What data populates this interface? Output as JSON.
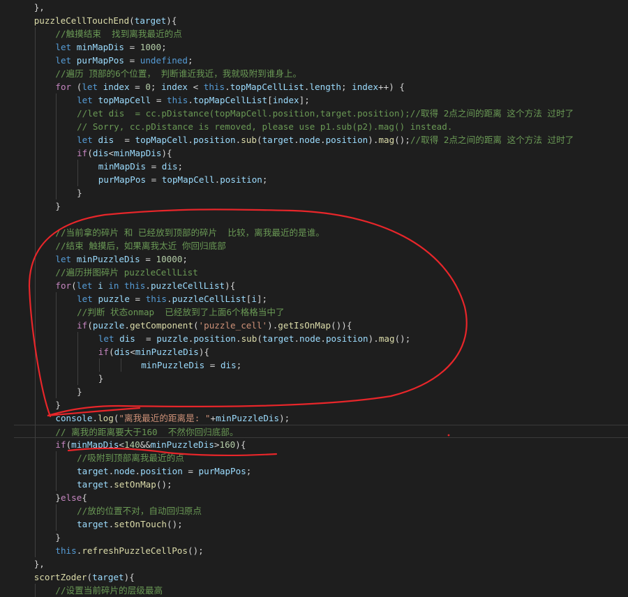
{
  "editor": {
    "lines": [
      {
        "indent": 1,
        "tokens": [
          [
            "},",
            "p"
          ]
        ]
      },
      {
        "indent": 1,
        "tokens": [
          [
            "puzzleCellTouchEnd",
            "f"
          ],
          [
            "(",
            "p"
          ],
          [
            "target",
            "v"
          ],
          [
            "){",
            "p"
          ]
        ]
      },
      {
        "indent": 2,
        "tokens": [
          [
            "//触摸结束  找到离我最近的点",
            "c"
          ]
        ]
      },
      {
        "indent": 2,
        "tokens": [
          [
            "let ",
            "k"
          ],
          [
            "minMapDis",
            "v"
          ],
          [
            " = ",
            "p"
          ],
          [
            "1000",
            "n"
          ],
          [
            ";",
            "p"
          ]
        ]
      },
      {
        "indent": 2,
        "tokens": [
          [
            "let ",
            "k"
          ],
          [
            "purMapPos",
            "v"
          ],
          [
            " = ",
            "p"
          ],
          [
            "undefined",
            "k"
          ],
          [
            ";",
            "p"
          ]
        ]
      },
      {
        "indent": 2,
        "tokens": [
          [
            "//遍历 顶部的6个位置， 判断谁近我近，我就吸附到谁身上。",
            "c"
          ]
        ]
      },
      {
        "indent": 2,
        "tokens": [
          [
            "for",
            "x"
          ],
          [
            " (",
            "p"
          ],
          [
            "let ",
            "k"
          ],
          [
            "index",
            "v"
          ],
          [
            " = ",
            "p"
          ],
          [
            "0",
            "n"
          ],
          [
            "; ",
            "p"
          ],
          [
            "index",
            "v"
          ],
          [
            " < ",
            "p"
          ],
          [
            "this",
            "k"
          ],
          [
            ".",
            "p"
          ],
          [
            "topMapCellList",
            "v"
          ],
          [
            ".",
            "p"
          ],
          [
            "length",
            "v"
          ],
          [
            "; ",
            "p"
          ],
          [
            "index",
            "v"
          ],
          [
            "++) {",
            "p"
          ]
        ]
      },
      {
        "indent": 3,
        "tokens": [
          [
            "let ",
            "k"
          ],
          [
            "topMapCell",
            "v"
          ],
          [
            " = ",
            "p"
          ],
          [
            "this",
            "k"
          ],
          [
            ".",
            "p"
          ],
          [
            "topMapCellList",
            "v"
          ],
          [
            "[",
            "p"
          ],
          [
            "index",
            "v"
          ],
          [
            "];",
            "p"
          ]
        ]
      },
      {
        "indent": 3,
        "tokens": [
          [
            "//let dis  = cc.pDistance(topMapCell.position,target.position);//取得 2点之间的距离 这个方法 过时了",
            "c"
          ]
        ]
      },
      {
        "indent": 3,
        "tokens": [
          [
            "// Sorry, cc.pDistance is removed, please use p1.sub(p2).mag() instead.",
            "c"
          ]
        ]
      },
      {
        "indent": 3,
        "tokens": [
          [
            "let ",
            "k"
          ],
          [
            "dis",
            "v"
          ],
          [
            "  = ",
            "p"
          ],
          [
            "topMapCell",
            "v"
          ],
          [
            ".",
            "p"
          ],
          [
            "position",
            "v"
          ],
          [
            ".",
            "p"
          ],
          [
            "sub",
            "f"
          ],
          [
            "(",
            "p"
          ],
          [
            "target",
            "v"
          ],
          [
            ".",
            "p"
          ],
          [
            "node",
            "v"
          ],
          [
            ".",
            "p"
          ],
          [
            "position",
            "v"
          ],
          [
            ").",
            "p"
          ],
          [
            "mag",
            "f"
          ],
          [
            "();",
            "p"
          ],
          [
            "//取得 2点之间的距离 这个方法 过时了",
            "c"
          ]
        ]
      },
      {
        "indent": 3,
        "tokens": [
          [
            "if",
            "x"
          ],
          [
            "(",
            "p"
          ],
          [
            "dis",
            "v"
          ],
          [
            "<",
            "p"
          ],
          [
            "minMapDis",
            "v"
          ],
          [
            "){",
            "p"
          ]
        ]
      },
      {
        "indent": 4,
        "tokens": [
          [
            "minMapDis",
            "v"
          ],
          [
            " = ",
            "p"
          ],
          [
            "dis",
            "v"
          ],
          [
            ";",
            "p"
          ]
        ]
      },
      {
        "indent": 4,
        "tokens": [
          [
            "purMapPos",
            "v"
          ],
          [
            " = ",
            "p"
          ],
          [
            "topMapCell",
            "v"
          ],
          [
            ".",
            "p"
          ],
          [
            "position",
            "v"
          ],
          [
            ";",
            "p"
          ]
        ]
      },
      {
        "indent": 3,
        "tokens": [
          [
            "}",
            "p"
          ]
        ]
      },
      {
        "indent": 2,
        "tokens": [
          [
            "}",
            "p"
          ]
        ]
      },
      {
        "indent": 0,
        "tokens": []
      },
      {
        "indent": 2,
        "tokens": [
          [
            "//当前拿的碎片 和 已经放到顶部的碎片  比较，离我最近的是谁。",
            "c"
          ]
        ]
      },
      {
        "indent": 2,
        "tokens": [
          [
            "//结束 触摸后，如果离我太近 你回归底部",
            "c"
          ]
        ]
      },
      {
        "indent": 2,
        "tokens": [
          [
            "let ",
            "k"
          ],
          [
            "minPuzzleDis",
            "v"
          ],
          [
            " = ",
            "p"
          ],
          [
            "10000",
            "n"
          ],
          [
            ";",
            "p"
          ]
        ]
      },
      {
        "indent": 2,
        "tokens": [
          [
            "//遍历拼图碎片 puzzleCellList",
            "c"
          ]
        ]
      },
      {
        "indent": 2,
        "tokens": [
          [
            "for",
            "x"
          ],
          [
            "(",
            "p"
          ],
          [
            "let ",
            "k"
          ],
          [
            "i",
            "v"
          ],
          [
            " in ",
            "k"
          ],
          [
            "this",
            "k"
          ],
          [
            ".",
            "p"
          ],
          [
            "puzzleCellList",
            "v"
          ],
          [
            "){",
            "p"
          ]
        ]
      },
      {
        "indent": 3,
        "tokens": [
          [
            "let ",
            "k"
          ],
          [
            "puzzle",
            "v"
          ],
          [
            " = ",
            "p"
          ],
          [
            "this",
            "k"
          ],
          [
            ".",
            "p"
          ],
          [
            "puzzleCellList",
            "v"
          ],
          [
            "[",
            "p"
          ],
          [
            "i",
            "v"
          ],
          [
            "];",
            "p"
          ]
        ]
      },
      {
        "indent": 3,
        "tokens": [
          [
            "//判断 状态onmap  已经放到了上面6个格格当中了",
            "c"
          ]
        ]
      },
      {
        "indent": 3,
        "tokens": [
          [
            "if",
            "x"
          ],
          [
            "(",
            "p"
          ],
          [
            "puzzle",
            "v"
          ],
          [
            ".",
            "p"
          ],
          [
            "getComponent",
            "f"
          ],
          [
            "(",
            "p"
          ],
          [
            "'puzzle_cell'",
            "s"
          ],
          [
            ").",
            "p"
          ],
          [
            "getIsOnMap",
            "f"
          ],
          [
            "()){",
            "p"
          ]
        ]
      },
      {
        "indent": 4,
        "tokens": [
          [
            "let ",
            "k"
          ],
          [
            "dis",
            "v"
          ],
          [
            "  = ",
            "p"
          ],
          [
            "puzzle",
            "v"
          ],
          [
            ".",
            "p"
          ],
          [
            "position",
            "v"
          ],
          [
            ".",
            "p"
          ],
          [
            "sub",
            "f"
          ],
          [
            "(",
            "p"
          ],
          [
            "target",
            "v"
          ],
          [
            ".",
            "p"
          ],
          [
            "node",
            "v"
          ],
          [
            ".",
            "p"
          ],
          [
            "position",
            "v"
          ],
          [
            ").",
            "p"
          ],
          [
            "mag",
            "f"
          ],
          [
            "();",
            "p"
          ]
        ]
      },
      {
        "indent": 4,
        "tokens": [
          [
            "if",
            "x"
          ],
          [
            "(",
            "p"
          ],
          [
            "dis",
            "v"
          ],
          [
            "<",
            "p"
          ],
          [
            "minPuzzleDis",
            "v"
          ],
          [
            "){",
            "p"
          ]
        ]
      },
      {
        "indent": 6,
        "tokens": [
          [
            "minPuzzleDis",
            "v"
          ],
          [
            " = ",
            "p"
          ],
          [
            "dis",
            "v"
          ],
          [
            ";",
            "p"
          ]
        ]
      },
      {
        "indent": 4,
        "tokens": [
          [
            "}",
            "p"
          ]
        ]
      },
      {
        "indent": 3,
        "tokens": [
          [
            "}",
            "p"
          ]
        ]
      },
      {
        "indent": 2,
        "tokens": [
          [
            "}",
            "p"
          ]
        ]
      },
      {
        "indent": 2,
        "tokens": [
          [
            "console",
            "v"
          ],
          [
            ".",
            "p"
          ],
          [
            "log",
            "f"
          ],
          [
            "(",
            "p"
          ],
          [
            "\"离我最近的距离是: \"",
            "s"
          ],
          [
            "+",
            "p"
          ],
          [
            "minPuzzleDis",
            "v"
          ],
          [
            ");",
            "p"
          ]
        ]
      },
      {
        "indent": 2,
        "tokens": [
          [
            "// 离我的距离要大于160  不然你回归底部。",
            "c"
          ]
        ]
      },
      {
        "indent": 2,
        "tokens": [
          [
            "if",
            "x"
          ],
          [
            "(",
            "p"
          ],
          [
            "minMapDis",
            "v"
          ],
          [
            "<",
            "p"
          ],
          [
            "140",
            "n"
          ],
          [
            "&&",
            "p"
          ],
          [
            "minPuzzleDis",
            "v"
          ],
          [
            ">",
            "p"
          ],
          [
            "160",
            "n"
          ],
          [
            "){",
            "p"
          ]
        ]
      },
      {
        "indent": 3,
        "tokens": [
          [
            "//吸附到顶部离我最近的点",
            "c"
          ]
        ]
      },
      {
        "indent": 3,
        "tokens": [
          [
            "target",
            "v"
          ],
          [
            ".",
            "p"
          ],
          [
            "node",
            "v"
          ],
          [
            ".",
            "p"
          ],
          [
            "position",
            "v"
          ],
          [
            " = ",
            "p"
          ],
          [
            "purMapPos",
            "v"
          ],
          [
            ";",
            "p"
          ]
        ]
      },
      {
        "indent": 3,
        "tokens": [
          [
            "target",
            "v"
          ],
          [
            ".",
            "p"
          ],
          [
            "setOnMap",
            "f"
          ],
          [
            "();",
            "p"
          ]
        ]
      },
      {
        "indent": 2,
        "tokens": [
          [
            "}",
            "p"
          ],
          [
            "else",
            "x"
          ],
          [
            "{",
            "p"
          ]
        ]
      },
      {
        "indent": 3,
        "tokens": [
          [
            "//放的位置不对，自动回归原点",
            "c"
          ]
        ]
      },
      {
        "indent": 3,
        "tokens": [
          [
            "target",
            "v"
          ],
          [
            ".",
            "p"
          ],
          [
            "setOnTouch",
            "f"
          ],
          [
            "();",
            "p"
          ]
        ]
      },
      {
        "indent": 2,
        "tokens": [
          [
            "}",
            "p"
          ]
        ]
      },
      {
        "indent": 2,
        "tokens": [
          [
            "this",
            "k"
          ],
          [
            ".",
            "p"
          ],
          [
            "refreshPuzzleCellPos",
            "f"
          ],
          [
            "();",
            "p"
          ]
        ]
      },
      {
        "indent": 1,
        "tokens": [
          [
            "},",
            "p"
          ]
        ]
      },
      {
        "indent": 1,
        "tokens": [
          [
            "scortZoder",
            "f"
          ],
          [
            "(",
            "p"
          ],
          [
            "target",
            "v"
          ],
          [
            "){",
            "p"
          ]
        ]
      },
      {
        "indent": 2,
        "tokens": [
          [
            "//设置当前碎片的层级最高",
            "c"
          ]
        ]
      }
    ]
  },
  "colors": {
    "background": "#1e1e1e",
    "text": "#d4d4d4",
    "keyword": "#569cd6",
    "control": "#c586c0",
    "variable": "#9cdcfe",
    "function": "#dcdcaa",
    "string": "#ce9178",
    "number": "#b5cea8",
    "comment": "#6a9955",
    "annotation": "#e8262a"
  }
}
